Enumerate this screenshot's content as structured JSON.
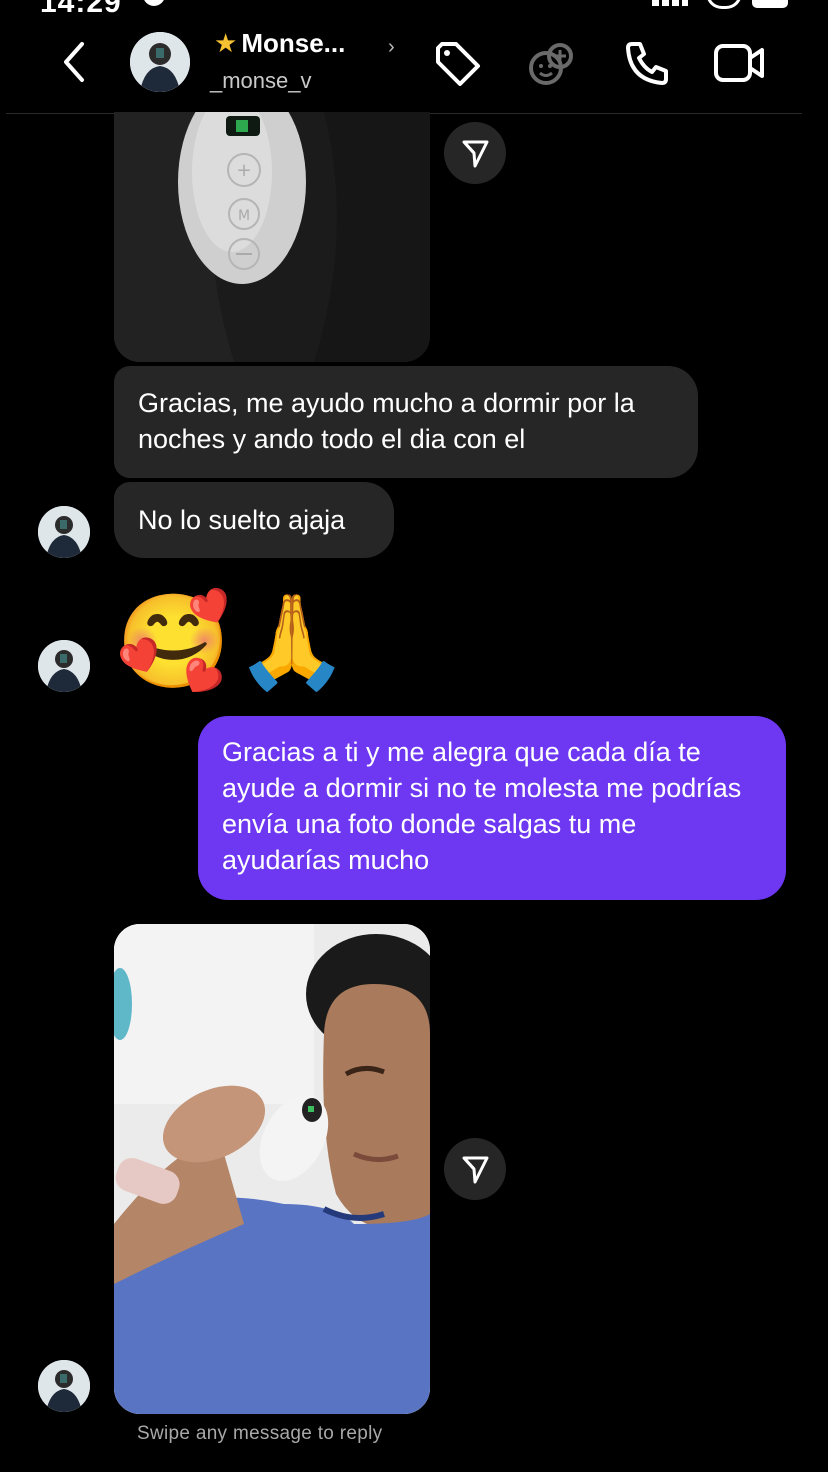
{
  "status_bar": {
    "time": "14:29"
  },
  "header": {
    "display_name": "Monse...",
    "name_prefix_emoji": "★",
    "username": "_monse_v",
    "icons": [
      "back-arrow-icon",
      "tag-icon",
      "effects-icon",
      "phone-icon",
      "video-call-icon"
    ]
  },
  "messages": [
    {
      "type": "image",
      "from": "other",
      "description_icon": "device-photo"
    },
    {
      "type": "text",
      "from": "other",
      "text": "Gracias, me ayudo mucho a dormir por la noches y ando todo el dia con el"
    },
    {
      "type": "text",
      "from": "other",
      "text": "No lo suelto ajaja"
    },
    {
      "type": "emoji",
      "from": "other",
      "text": "🥰🙏"
    },
    {
      "type": "text",
      "from": "me",
      "text": "Gracias a ti y me alegra que cada día te ayude a dormir  si no te molesta me podrías envía una foto donde salgas tu me ayudarías mucho"
    },
    {
      "type": "image",
      "from": "other",
      "description_icon": "selfie-photo"
    }
  ],
  "footer": {
    "hint": "Swipe any message to reply"
  },
  "colors": {
    "background": "#000000",
    "received_bubble": "#262626",
    "sent_bubble": "#6e38f2",
    "accent_star": "#f6c232"
  }
}
